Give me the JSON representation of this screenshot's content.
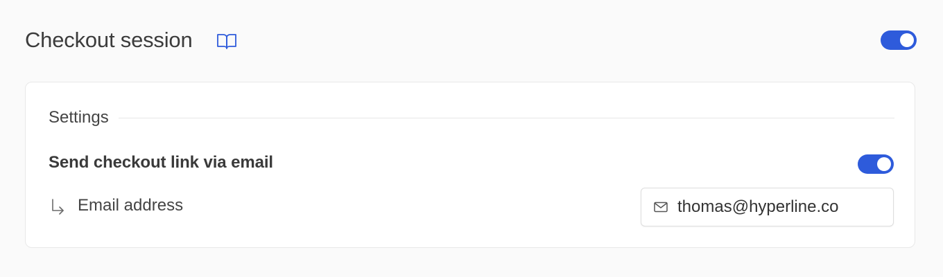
{
  "header": {
    "title": "Checkout session",
    "doc_icon": "open-book-icon",
    "enabled": true
  },
  "settings": {
    "section_title": "Settings",
    "send_link_label": "Send checkout link via email",
    "send_link_enabled": true,
    "email_label": "Email address",
    "email_value": "thomas@hyperline.co",
    "email_icon": "mail-icon",
    "indent_icon": "return-arrow-icon"
  },
  "colors": {
    "accent": "#2e5bdb",
    "background": "#fafafa",
    "card": "#ffffff"
  }
}
